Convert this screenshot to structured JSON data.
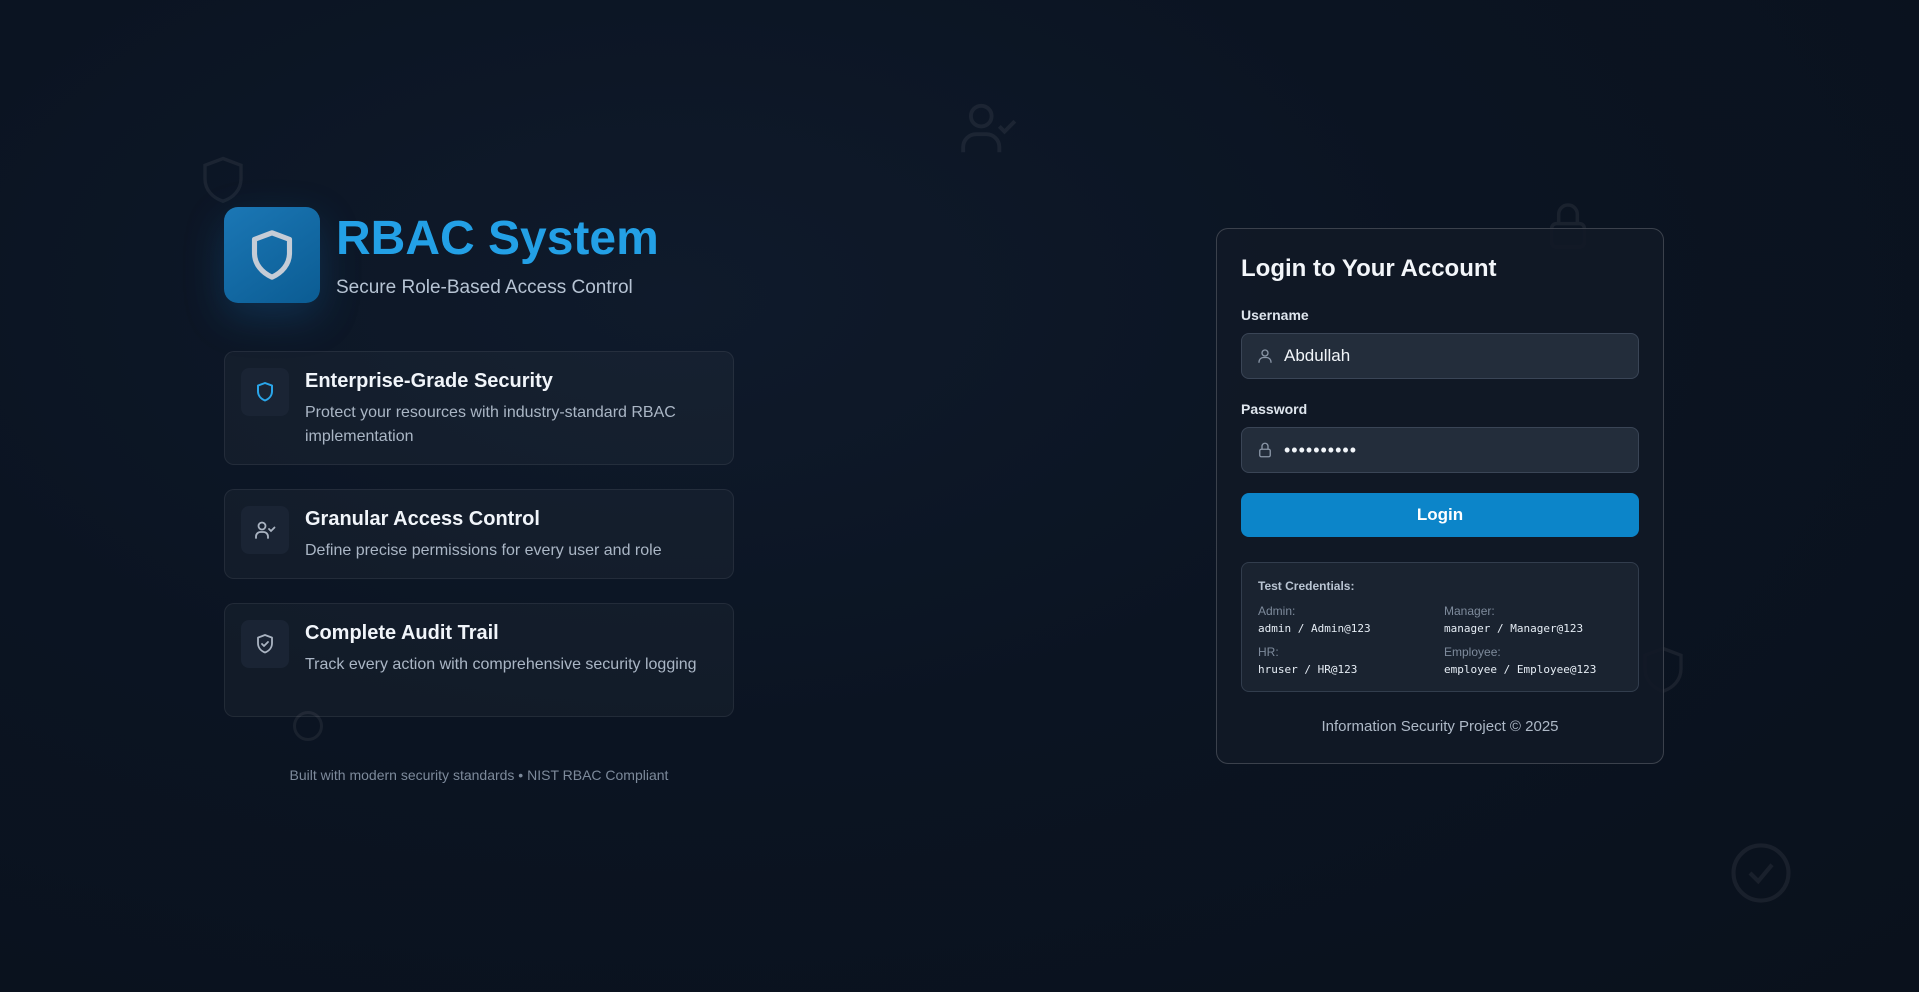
{
  "brand": {
    "title": "RBAC System",
    "subtitle": "Secure Role-Based Access Control",
    "icon": "shield-icon",
    "accent": "#23a0e6"
  },
  "features": [
    {
      "icon": "shield-icon",
      "title": "Enterprise-Grade Security",
      "description": "Protect your resources with industry-standard RBAC implementation"
    },
    {
      "icon": "user-check-icon",
      "title": "Granular Access Control",
      "description": "Define precise permissions for every user and role"
    },
    {
      "icon": "shield-check-icon",
      "title": "Complete Audit Trail",
      "description": "Track every action with comprehensive security logging"
    }
  ],
  "footnote": "Built with modern security standards • NIST RBAC Compliant",
  "login": {
    "title": "Login to Your Account",
    "username_label": "Username",
    "username_value": "Abdullah",
    "password_label": "Password",
    "password_value": "••••••••••",
    "button_label": "Login",
    "button_color": "#0c85c9"
  },
  "credentials": {
    "title": "Test Credentials:",
    "items": [
      {
        "role": "Admin:",
        "value": "admin / Admin@123"
      },
      {
        "role": "Manager:",
        "value": "manager / Manager@123"
      },
      {
        "role": "HR:",
        "value": "hruser / HR@123"
      },
      {
        "role": "Employee:",
        "value": "employee / Employee@123"
      }
    ]
  },
  "card_footer": "Information Security Project © 2025"
}
